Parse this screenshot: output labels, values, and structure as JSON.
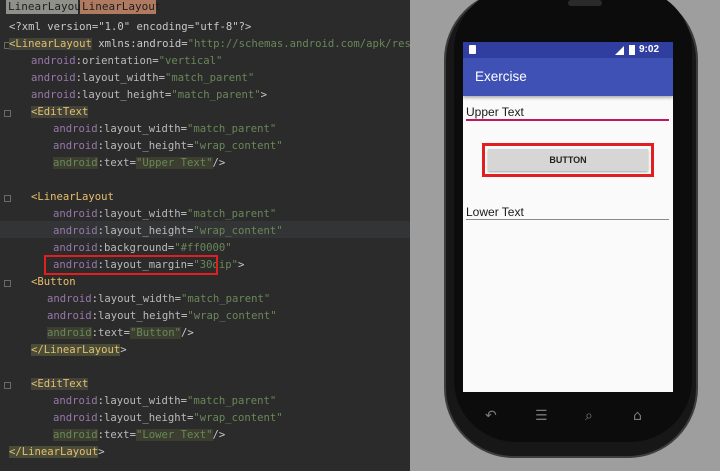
{
  "editor": {
    "tabs": [
      "LinearLayout",
      "LinearLayout"
    ],
    "lines": [
      {
        "text": "<?xml version=\"1.0\" encoding=\"utf-8\"?>"
      },
      {
        "text": "<LinearLayout xmlns:android=\"http://schemas.android.com/apk/res/android\""
      },
      {
        "text": "android:orientation=\"vertical\""
      },
      {
        "text": "android:layout_width=\"match_parent\""
      },
      {
        "text": "android:layout_height=\"match_parent\">"
      },
      {
        "text": "<EditText"
      },
      {
        "text": "android:layout_width=\"match_parent\""
      },
      {
        "text": "android:layout_height=\"wrap_content\""
      },
      {
        "text": "android:text=\"Upper Text\"/>"
      },
      {
        "text": "<LinearLayout"
      },
      {
        "text": "android:layout_width=\"match_parent\""
      },
      {
        "text": "android:layout_height=\"wrap_content\""
      },
      {
        "text": "android:background=\"#ff0000\""
      },
      {
        "text": "android:layout_margin=\"30dip\">"
      },
      {
        "text": "<Button"
      },
      {
        "text": "android:layout_width=\"match_parent\""
      },
      {
        "text": "android:layout_height=\"wrap_content\""
      },
      {
        "text": "android:text=\"Button\"/>"
      },
      {
        "text": "</LinearLayout>"
      },
      {
        "text": "<EditText"
      },
      {
        "text": "android:layout_width=\"match_parent\""
      },
      {
        "text": "android:layout_height=\"wrap_content\""
      },
      {
        "text": "android:text=\"Lower Text\"/>"
      },
      {
        "text": "</LinearLayout>"
      }
    ]
  },
  "device": {
    "status_time": "9:02",
    "app_title": "Exercise",
    "upper_text": "Upper Text",
    "button_label": "BUTTON",
    "lower_text": "Lower Text",
    "nav_icons": [
      "back-icon",
      "menu-icon",
      "search-icon",
      "home-icon"
    ]
  },
  "colors": {
    "editor_bg": "#2b2b2b",
    "tag": "#e8bf6a",
    "attr_ns": "#9876aa",
    "value": "#6a8759",
    "highlight_box": "#e02020",
    "appbar": "#3f51b5",
    "statusbar": "#303f9f",
    "accent": "#c2185b"
  }
}
